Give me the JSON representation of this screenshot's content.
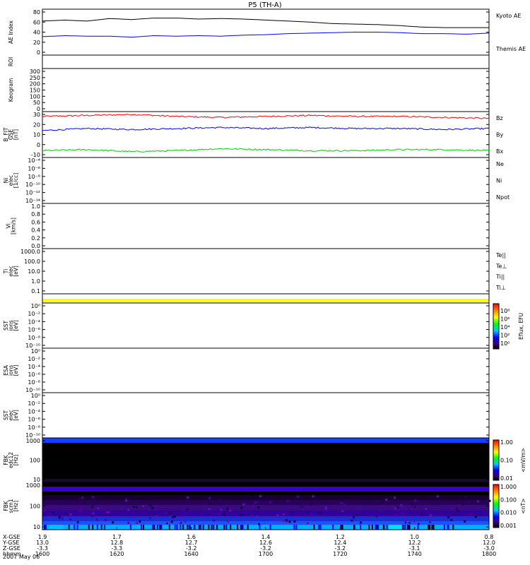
{
  "chart_data": {
    "type": "line",
    "title": "P5 (TH-A)",
    "date_label": "2007 May 06",
    "x_axis": {
      "ticks": [
        "1600",
        "1620",
        "1640",
        "1700",
        "1720",
        "1740",
        "1800"
      ],
      "rows": [
        {
          "label": "X-GSE",
          "values": [
            "1.9",
            "1.7",
            "1.6",
            "1.4",
            "1.2",
            "1.0",
            "0.8"
          ]
        },
        {
          "label": "Y-GSE",
          "values": [
            "13.0",
            "12.8",
            "12.7",
            "12.6",
            "12.4",
            "12.2",
            "12.0"
          ]
        },
        {
          "label": "Z-GSE",
          "values": [
            "-3.3",
            "-3.3",
            "-3.2",
            "-3.2",
            "-3.2",
            "-3.1",
            "-3.0"
          ]
        },
        {
          "label": "hhmm",
          "values": [
            "1600",
            "1620",
            "1640",
            "1700",
            "1720",
            "1740",
            "1800"
          ]
        }
      ]
    },
    "panels": [
      {
        "id": "ae",
        "ylabel": [
          "AE Index"
        ],
        "yticks": [
          "80",
          "60",
          "40",
          "20",
          "0"
        ],
        "ylim": [
          0,
          80
        ],
        "legend": [
          {
            "name": "Kyoto AE",
            "color": "#0000ff"
          },
          {
            "name": "Themis AE",
            "color": "#000000"
          }
        ],
        "series": [
          {
            "name": "Themis AE",
            "color": "#000000",
            "t": [
              0,
              0.05,
              0.1,
              0.15,
              0.2,
              0.25,
              0.3,
              0.35,
              0.4,
              0.45,
              0.5,
              0.55,
              0.6,
              0.65,
              0.7,
              0.75,
              0.8,
              0.85,
              0.9,
              0.95,
              1.0
            ],
            "y": [
              62,
              64,
              62,
              67,
              65,
              68,
              68,
              66,
              67,
              66,
              64,
              62,
              60,
              57,
              56,
              55,
              53,
              50,
              49,
              49,
              49
            ]
          },
          {
            "name": "Kyoto AE",
            "color": "#0000ff",
            "t": [
              0,
              0.05,
              0.1,
              0.15,
              0.2,
              0.25,
              0.3,
              0.35,
              0.4,
              0.45,
              0.5,
              0.55,
              0.6,
              0.65,
              0.7,
              0.75,
              0.8,
              0.85,
              0.9,
              0.95,
              1.0
            ],
            "y": [
              31,
              33,
              32,
              32,
              30,
              33,
              32,
              33,
              32,
              34,
              35,
              37,
              38,
              39,
              40,
              40,
              39,
              37,
              37,
              36,
              38
            ]
          }
        ]
      },
      {
        "id": "roi",
        "ylabel": [
          "ROI"
        ],
        "yticks": []
      },
      {
        "id": "keogram",
        "ylabel": [
          "Keogram"
        ],
        "yticks": [
          "300",
          "250",
          "200",
          "150",
          "100",
          "50",
          "0"
        ]
      },
      {
        "id": "bfield",
        "ylabel": [
          "B_FIT",
          "GSE",
          "[nT]"
        ],
        "yticks": [
          "30",
          "20",
          "10",
          "0",
          "-10"
        ],
        "ylim": [
          -10,
          30
        ],
        "legend": [
          {
            "name": "Bz",
            "color": "#ff0000"
          },
          {
            "name": "By",
            "color": "#00cc00"
          },
          {
            "name": "Bx",
            "color": "#0000ff"
          }
        ],
        "series": [
          {
            "name": "Bz",
            "color": "#ff0000",
            "t": [
              0,
              0.1,
              0.2,
              0.3,
              0.4,
              0.5,
              0.6,
              0.7,
              0.8,
              0.9,
              1.0
            ],
            "y": [
              28,
              29,
              30,
              28,
              27,
              28,
              29,
              28,
              28,
              27,
              26
            ]
          },
          {
            "name": "Bx",
            "color": "#0000ff",
            "t": [
              0,
              0.1,
              0.2,
              0.3,
              0.4,
              0.5,
              0.6,
              0.7,
              0.8,
              0.9,
              1.0
            ],
            "y": [
              14,
              16,
              15,
              16,
              17,
              16,
              17,
              16,
              16,
              15,
              16
            ]
          },
          {
            "name": "By",
            "color": "#00cc00",
            "t": [
              0,
              0.1,
              0.2,
              0.3,
              0.4,
              0.5,
              0.6,
              0.7,
              0.8,
              0.9,
              1.0
            ],
            "y": [
              -6,
              -5,
              -7,
              -6,
              -4,
              -5,
              -6,
              -6,
              -5,
              -5,
              -6
            ]
          }
        ]
      },
      {
        "id": "density",
        "ylabel": [
          "Ni",
          "elec",
          "[1/cc]"
        ],
        "yticks": [
          "10⁻⁴",
          "10⁻⁶",
          "10⁻⁸",
          "10⁻¹⁰",
          "10⁻¹²",
          "10⁻¹⁴"
        ],
        "legend": [
          {
            "name": "Ne",
            "color": "#ff0000"
          },
          {
            "name": "Ni",
            "color": "#000000"
          },
          {
            "name": "Npot",
            "color": "#0000ff"
          }
        ]
      },
      {
        "id": "velocity",
        "ylabel": [
          "Vi",
          "[km/s]"
        ],
        "yticks": [
          "1.0",
          "0.8",
          "0.6",
          "0.4",
          "0.2",
          "0.0"
        ]
      },
      {
        "id": "temperature",
        "ylabel": [
          "Ti",
          "elec",
          "[eV]"
        ],
        "yticks": [
          "1000.0",
          "100.0",
          "10.0",
          "1.0",
          "0.1"
        ],
        "legend": [
          {
            "name": "Te||",
            "color": "#000000"
          },
          {
            "name": "Te⊥",
            "color": "#ff0000"
          },
          {
            "name": "Ti||",
            "color": "#00cc00"
          },
          {
            "name": "Ti⊥",
            "color": "#0000ff"
          }
        ]
      },
      {
        "id": "yellowbar",
        "ylabel": [],
        "yticks": []
      },
      {
        "id": "sst1",
        "ylabel": [
          "SST",
          "ions",
          "[eV]"
        ],
        "yticks": [
          "10⁰",
          "10⁻²",
          "10⁻⁴",
          "10⁻⁶",
          "10⁻⁸",
          "10⁻¹⁰"
        ]
      },
      {
        "id": "esa",
        "ylabel": [
          "ESA",
          "ions",
          "[eV]"
        ],
        "yticks": [
          "10⁰",
          "10⁻²",
          "10⁻⁴",
          "10⁻⁶",
          "10⁻⁸",
          "10⁻¹⁰"
        ]
      },
      {
        "id": "sst2",
        "ylabel": [
          "SST",
          "elec",
          "[eV]"
        ],
        "yticks": [
          "10⁰",
          "10⁻²",
          "10⁻⁴",
          "10⁻⁶",
          "10⁻⁸",
          "10⁻¹⁰"
        ]
      },
      {
        "id": "fbk1",
        "ylabel": [
          "FBK",
          "edc12",
          "[Hz]"
        ],
        "yticks": [
          "1000",
          "100",
          "10"
        ],
        "colorbar": {
          "ticks": [
            "1.00",
            "0.10",
            "0.01"
          ],
          "label": "<mV/m>"
        }
      },
      {
        "id": "fbk2",
        "ylabel": [
          "FBK",
          "scm1",
          "[Hz]"
        ],
        "yticks": [
          "1000",
          "100",
          "10"
        ],
        "colorbar": {
          "ticks": [
            "1.000",
            "0.100",
            "0.010",
            "0.001"
          ],
          "label": "<nT>"
        }
      }
    ],
    "flux_colorbar": {
      "ticks": [
        "10⁸",
        "10⁶",
        "10⁴",
        "10²",
        "10⁰"
      ],
      "label": "Eflux, EFU"
    }
  }
}
